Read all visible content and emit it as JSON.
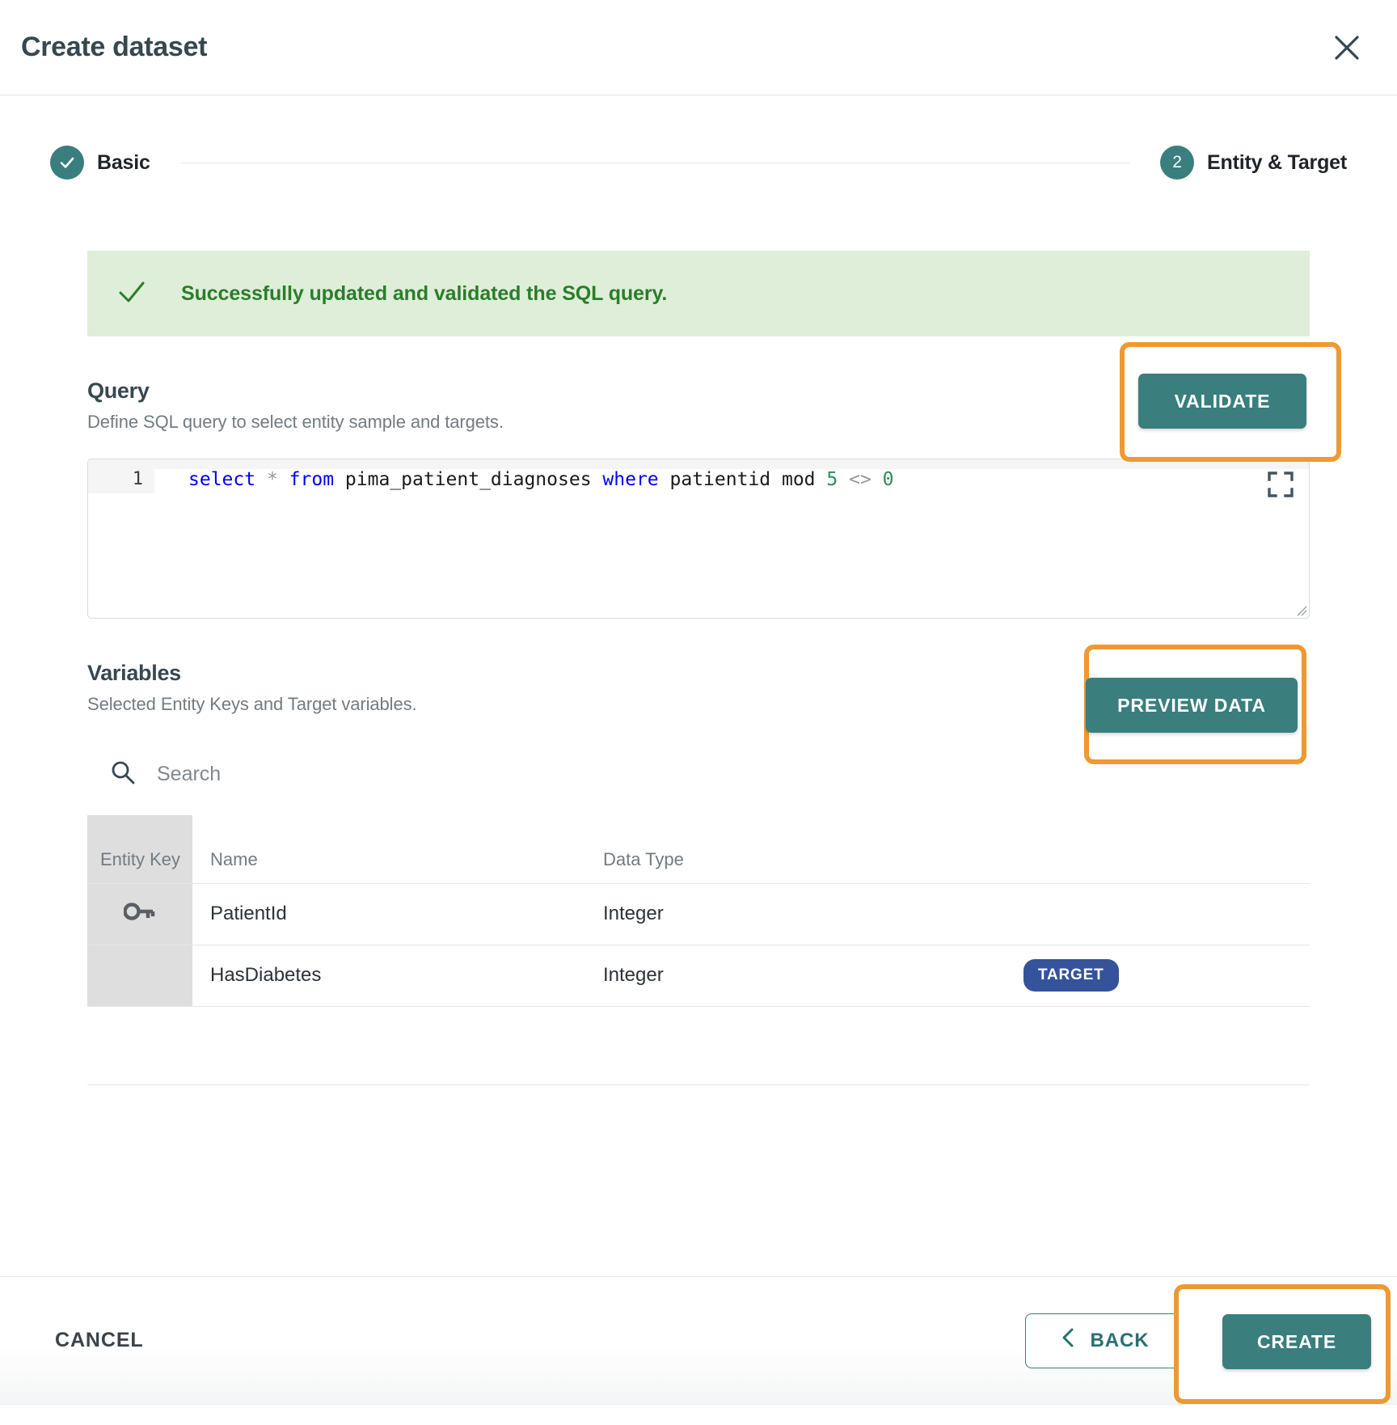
{
  "dialog": {
    "title": "Create dataset",
    "close_icon": "close-icon"
  },
  "stepper": {
    "steps": [
      {
        "label": "Basic",
        "marker": "check-icon",
        "state": "completed"
      },
      {
        "label": "Entity & Target",
        "marker": "2",
        "state": "active"
      }
    ]
  },
  "alert": {
    "icon": "check-icon",
    "message": "Successfully updated and validated the SQL query.",
    "background_color": "#dfeed9",
    "text_color": "#2b7d2b"
  },
  "query_section": {
    "title": "Query",
    "subtitle": "Define SQL query to select entity sample and targets.",
    "validate_label": "VALIDATE",
    "editor": {
      "line_number": "1",
      "tokens": [
        {
          "text": "select",
          "type": "keyword"
        },
        {
          "text": " ",
          "type": "plain"
        },
        {
          "text": "*",
          "type": "operator"
        },
        {
          "text": " ",
          "type": "plain"
        },
        {
          "text": "from",
          "type": "keyword"
        },
        {
          "text": " pima_patient_diagnoses ",
          "type": "plain"
        },
        {
          "text": "where",
          "type": "keyword"
        },
        {
          "text": " patientid mod ",
          "type": "plain"
        },
        {
          "text": "5",
          "type": "number"
        },
        {
          "text": " ",
          "type": "plain"
        },
        {
          "text": "<>",
          "type": "operator"
        },
        {
          "text": " ",
          "type": "plain"
        },
        {
          "text": "0",
          "type": "number"
        }
      ],
      "expand_icon": "fullscreen-icon"
    }
  },
  "variables_section": {
    "title": "Variables",
    "subtitle": "Selected Entity Keys and Target variables.",
    "preview_label": "PREVIEW DATA",
    "search_placeholder": "Search",
    "search_value": "",
    "search_icon": "search-icon",
    "table": {
      "headers": [
        "Entity Key",
        "Name",
        "Data Type",
        ""
      ],
      "rows": [
        {
          "entity_key": true,
          "key_icon": "key-icon",
          "name": "PatientId",
          "data_type": "Integer",
          "badge": ""
        },
        {
          "entity_key": false,
          "key_icon": "",
          "name": "HasDiabetes",
          "data_type": "Integer",
          "badge": "TARGET"
        }
      ]
    }
  },
  "footer": {
    "cancel_label": "CANCEL",
    "back_label": "BACK",
    "back_icon": "chevron-left-icon",
    "create_label": "CREATE"
  },
  "highlights": {
    "color": "#ee9933",
    "targets": [
      "VALIDATE",
      "PREVIEW DATA",
      "CREATE"
    ]
  },
  "colors": {
    "accent_teal": "#3a7e7e",
    "target_badge": "#34539b",
    "highlight_orange": "#ee9933",
    "success_green": "#2b7d2b"
  }
}
